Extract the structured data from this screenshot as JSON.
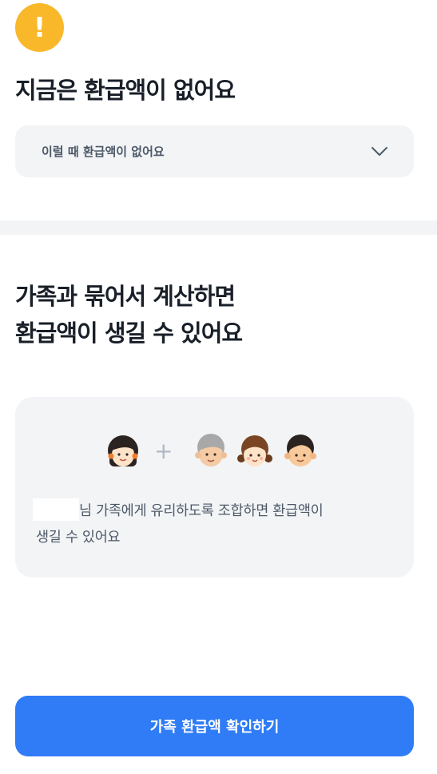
{
  "alert": {
    "icon": "exclamation-icon",
    "glyph": "!",
    "color": "#f9b82a"
  },
  "header": {
    "title": "지금은 환급액이 없어요"
  },
  "dropdown": {
    "label": "이럴 때 환급액이 없어요",
    "icon": "chevron-down-icon"
  },
  "section": {
    "title_line1": "가족과 묶어서 계산하면",
    "title_line2": "환급액이 생길 수 있어요"
  },
  "card": {
    "faces": [
      "user-avatar",
      "grandparent-avatar",
      "girl-avatar",
      "boy-avatar"
    ],
    "plus": "+",
    "text_line1": "님 가족에게 유리하도록 조합하면 환급액이",
    "text_line2": "생길 수 있어요"
  },
  "cta": {
    "label": "가족 환급액 확인하기",
    "color": "#2f7cf6"
  }
}
